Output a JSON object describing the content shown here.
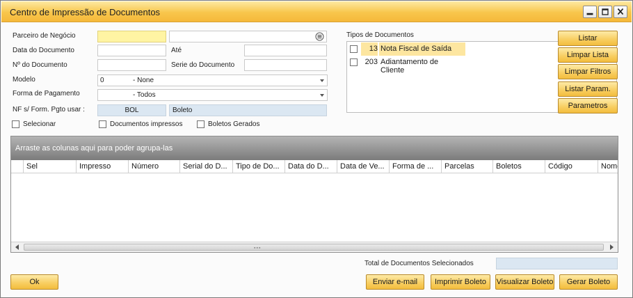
{
  "window": {
    "title": "Centro de Impressão de Documentos"
  },
  "filters": {
    "parceiro_label": "Parceiro de Negócio",
    "parceiro_value": "",
    "parceiro_name_value": "",
    "data_documento_label": "Data do Documento",
    "data_documento_value": "",
    "ate_label": "Até",
    "ate_value": "",
    "numero_documento_label": "Nº do Documento",
    "numero_documento_value": "",
    "serie_documento_label": "Serie do Documento",
    "serie_documento_value": "",
    "modelo_label": "Modelo",
    "modelo_code": "0",
    "modelo_value": "- None",
    "forma_pagamento_label": "Forma de Pagamento",
    "forma_pagamento_value": "- Todos",
    "nf_label": "NF s/ Form. Pgto usar :",
    "nf_code": "BOL",
    "nf_value": "Boleto",
    "selecionar_label": "Selecionar",
    "documentos_impressos_label": "Documentos impressos",
    "boletos_gerados_label": "Boletos Gerados"
  },
  "tipos_documentos": {
    "label": "Tipos de Documentos",
    "items": [
      {
        "code": "13",
        "name": "Nota Fiscal de Saída",
        "highlighted": true
      },
      {
        "code": "203",
        "name": "Adiantamento de Cliente",
        "highlighted": false
      }
    ]
  },
  "side_buttons": {
    "listar": "Listar",
    "limpar_lista": "Limpar Lista",
    "limpar_filtros": "Limpar Filtros",
    "listar_param": "Listar Param.",
    "parametros": "Parametros"
  },
  "grid": {
    "group_hint": "Arraste as colunas aqui para poder agrupa-las",
    "columns": [
      "Sel",
      "Impresso",
      "Número",
      "Serial do D...",
      "Tipo de Do...",
      "Data do D...",
      "Data de Ve...",
      "Forma de ...",
      "Parcelas",
      "Boletos",
      "Código",
      "Nome"
    ]
  },
  "footer": {
    "total_label": "Total de Documentos Selecionados",
    "total_value": "",
    "ok": "Ok",
    "enviar_email": "Enviar e-mail",
    "imprimir_boleto": "Imprimir Boleto",
    "visualizar_boleto": "Visualizar Boleto",
    "gerar_boleto": "Gerar Boleto"
  },
  "icons": {
    "minimize": "minimize-icon",
    "maximize": "maximize-icon",
    "close": "close-icon",
    "list_choose": "list-choose-icon",
    "dropdown": "chevron-down-icon"
  },
  "colors": {
    "titlebar": "#f8c64c",
    "button": "#f8cd5f",
    "mandatory_field": "#fff4a3",
    "readonly_field": "#dbe7f2",
    "highlight_row": "#fde6a0"
  }
}
